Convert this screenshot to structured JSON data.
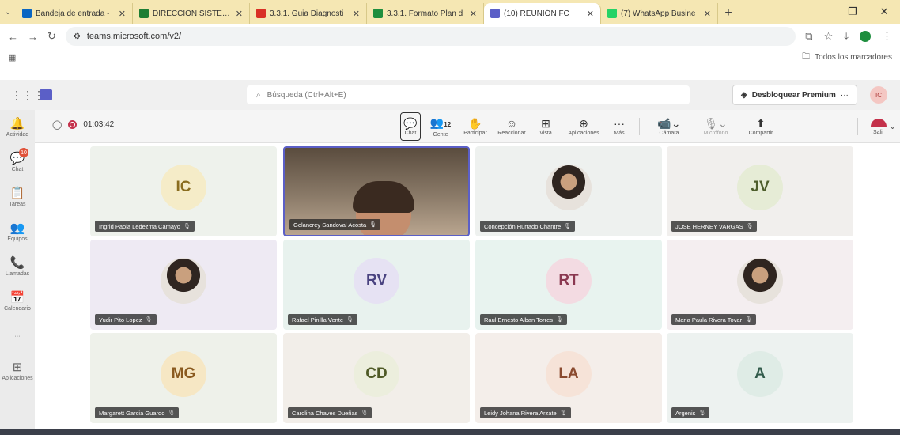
{
  "browser": {
    "tabs": [
      {
        "title": "Bandeja de entrada -",
        "color": "#0a66c2",
        "active": false
      },
      {
        "title": "DIRECCION SISTEMA",
        "color": "#1e7e34",
        "active": false
      },
      {
        "title": "3.3.1. Guia Diagnosti",
        "color": "#d93025",
        "active": false
      },
      {
        "title": "3.3.1. Formato Plan d",
        "color": "#1e8e3e",
        "active": false
      },
      {
        "title": "(10) REUNIÓN FC",
        "color": "#5b5fc7",
        "active": true
      },
      {
        "title": "(7) WhatsApp Busine",
        "color": "#25d366",
        "active": false
      }
    ],
    "url": "teams.microsoft.com/v2/",
    "all_bookmarks": "Todos los marcadores"
  },
  "teams": {
    "search_placeholder": "Búsqueda (Ctrl+Alt+E)",
    "premium_label": "Desbloquear Premium",
    "premium_more": "···",
    "user_initials": "IC"
  },
  "rail": [
    {
      "label": "Actividad",
      "icon": "🔔",
      "badge": ""
    },
    {
      "label": "Chat",
      "icon": "💬",
      "badge": "10"
    },
    {
      "label": "Tareas",
      "icon": "📋",
      "badge": ""
    },
    {
      "label": "Equipos",
      "icon": "👥",
      "badge": ""
    },
    {
      "label": "Llamadas",
      "icon": "📞",
      "badge": ""
    },
    {
      "label": "Calendario",
      "icon": "📅",
      "badge": ""
    },
    {
      "label": "···",
      "icon": "",
      "badge": ""
    },
    {
      "label": "Aplicaciones",
      "icon": "⊞",
      "badge": ""
    }
  ],
  "meeting": {
    "timer": "01:03:42",
    "tools": {
      "chat": "Chat",
      "people": "Gente",
      "people_count": "12",
      "raise": "Participar",
      "react": "Reaccionar",
      "view": "Vista",
      "apps": "Aplicaciones",
      "more": "Más",
      "camera": "Cámara",
      "mic": "Micrófono",
      "share": "Compartir",
      "leave": "Salir"
    }
  },
  "participants": [
    {
      "name": "Ingrid Paola Ledezma Camayo",
      "initials": "IC",
      "bg": "#eef2ec",
      "circle": "#f5ecc8",
      "fg": "#8a6d1f",
      "photo": false
    },
    {
      "name": "Gelancrey Sandoval Acosta",
      "initials": "",
      "bg": "#6b5b4a",
      "circle": "",
      "fg": "",
      "photo": true,
      "video": true
    },
    {
      "name": "Concepción Hurtado Chantre",
      "initials": "",
      "bg": "#eef1ef",
      "circle": "",
      "fg": "",
      "photo": true
    },
    {
      "name": "JOSE HERNEY VARGAS",
      "initials": "JV",
      "bg": "#f1efed",
      "circle": "#e6ecd6",
      "fg": "#4e5e2c",
      "photo": false
    },
    {
      "name": "Yudir Pito Lopez",
      "initials": "",
      "bg": "#eeeaf3",
      "circle": "",
      "fg": "",
      "photo": true
    },
    {
      "name": "Rafael Pinilla Vente",
      "initials": "RV",
      "bg": "#e8f2ee",
      "circle": "#e6e2f3",
      "fg": "#4a4380",
      "photo": false
    },
    {
      "name": "Raul Ernesto Alban Torres",
      "initials": "RT",
      "bg": "#e8f3ef",
      "circle": "#f3dbe2",
      "fg": "#8a3850",
      "photo": false
    },
    {
      "name": "Maria Paula Rivera Tovar",
      "initials": "",
      "bg": "#f4eef0",
      "circle": "",
      "fg": "",
      "photo": true
    },
    {
      "name": "Margarett Garcia Guardo",
      "initials": "MG",
      "bg": "#eef1ea",
      "circle": "#f6e7c4",
      "fg": "#8a5a1f",
      "photo": false
    },
    {
      "name": "Carolina Chaves Dueñas",
      "initials": "CD",
      "bg": "#f2eee9",
      "circle": "#eceedd",
      "fg": "#4f5a26",
      "photo": false
    },
    {
      "name": "Leidy Johana Rivera Arzate",
      "initials": "LA",
      "bg": "#f4eeea",
      "circle": "#f6e3d8",
      "fg": "#8a4a2f",
      "photo": false
    },
    {
      "name": "Argenis",
      "initials": "A",
      "bg": "#edf2f0",
      "circle": "#dfece6",
      "fg": "#305a4a",
      "photo": false
    }
  ]
}
